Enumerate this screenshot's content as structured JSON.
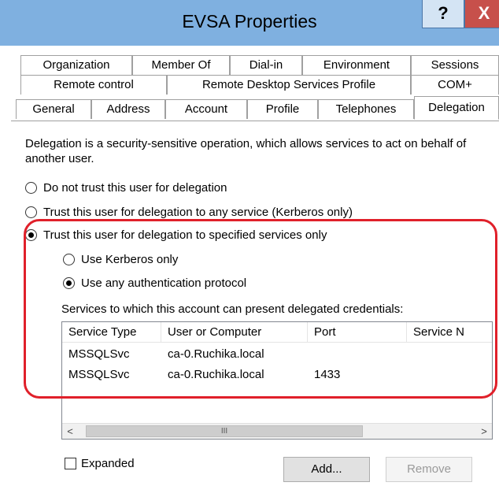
{
  "window": {
    "title": "EVSA Properties",
    "help_label": "?",
    "close_label": "X"
  },
  "tabs": {
    "row1": [
      "Organization",
      "Member Of",
      "Dial-in",
      "Environment",
      "Sessions"
    ],
    "row2": [
      "Remote control",
      "Remote Desktop Services Profile",
      "COM+"
    ],
    "row3": [
      "General",
      "Address",
      "Account",
      "Profile",
      "Telephones",
      "Delegation"
    ]
  },
  "description": "Delegation is a security-sensitive operation, which allows services to act on behalf of another user.",
  "options": {
    "no_trust": "Do not trust this user for delegation",
    "trust_any": "Trust this user for delegation to any service (Kerberos only)",
    "trust_specified": "Trust this user for delegation to specified services only",
    "kerberos_only": "Use Kerberos only",
    "any_protocol": "Use any authentication protocol",
    "selected": "trust_specified",
    "selected_sub": "any_protocol"
  },
  "services": {
    "label": "Services to which this account can present delegated credentials:",
    "columns": [
      "Service Type",
      "User or Computer",
      "Port",
      "Service N"
    ],
    "rows": [
      {
        "type": "MSSQLSvc",
        "host": "ca-0.Ruchika.local",
        "port": ""
      },
      {
        "type": "MSSQLSvc",
        "host": "ca-0.Ruchika.local",
        "port": "1433"
      }
    ],
    "scroll_left": "<",
    "scroll_right": ">",
    "scroll_thumb": "III"
  },
  "expanded_label": "Expanded",
  "buttons": {
    "add": "Add...",
    "remove": "Remove"
  },
  "colors": {
    "titlebar": "#7fb0e0",
    "highlight": "#e0202a",
    "close": "#c7504b"
  }
}
